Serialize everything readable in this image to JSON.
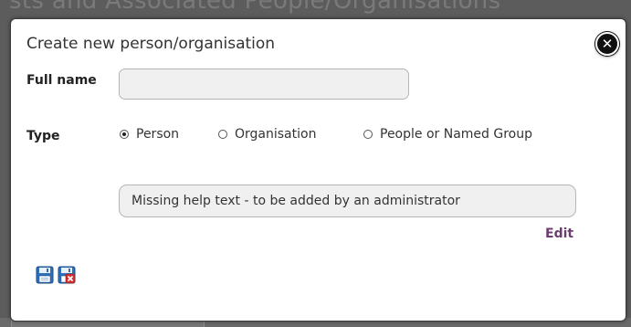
{
  "background": {
    "title_fragment": "sts and Associated People/Organisations"
  },
  "dialog": {
    "title": "Create new person/organisation",
    "close_icon": "close-icon"
  },
  "form": {
    "full_name": {
      "label": "Full name",
      "value": "",
      "placeholder": ""
    },
    "type": {
      "label": "Type",
      "options": [
        {
          "label": "Person",
          "selected": true
        },
        {
          "label": "Organisation",
          "selected": false
        },
        {
          "label": "People or Named Group",
          "selected": false
        }
      ]
    },
    "help_text": "Missing help text - to be added by an administrator",
    "edit_label": "Edit"
  },
  "actions": {
    "save_icon": "floppy-disk-save-icon",
    "cancel_icon": "floppy-disk-cancel-icon"
  },
  "colors": {
    "link": "#6b3d6f",
    "save_blue": "#2f6fb8",
    "cancel_red": "#d32f2f"
  }
}
